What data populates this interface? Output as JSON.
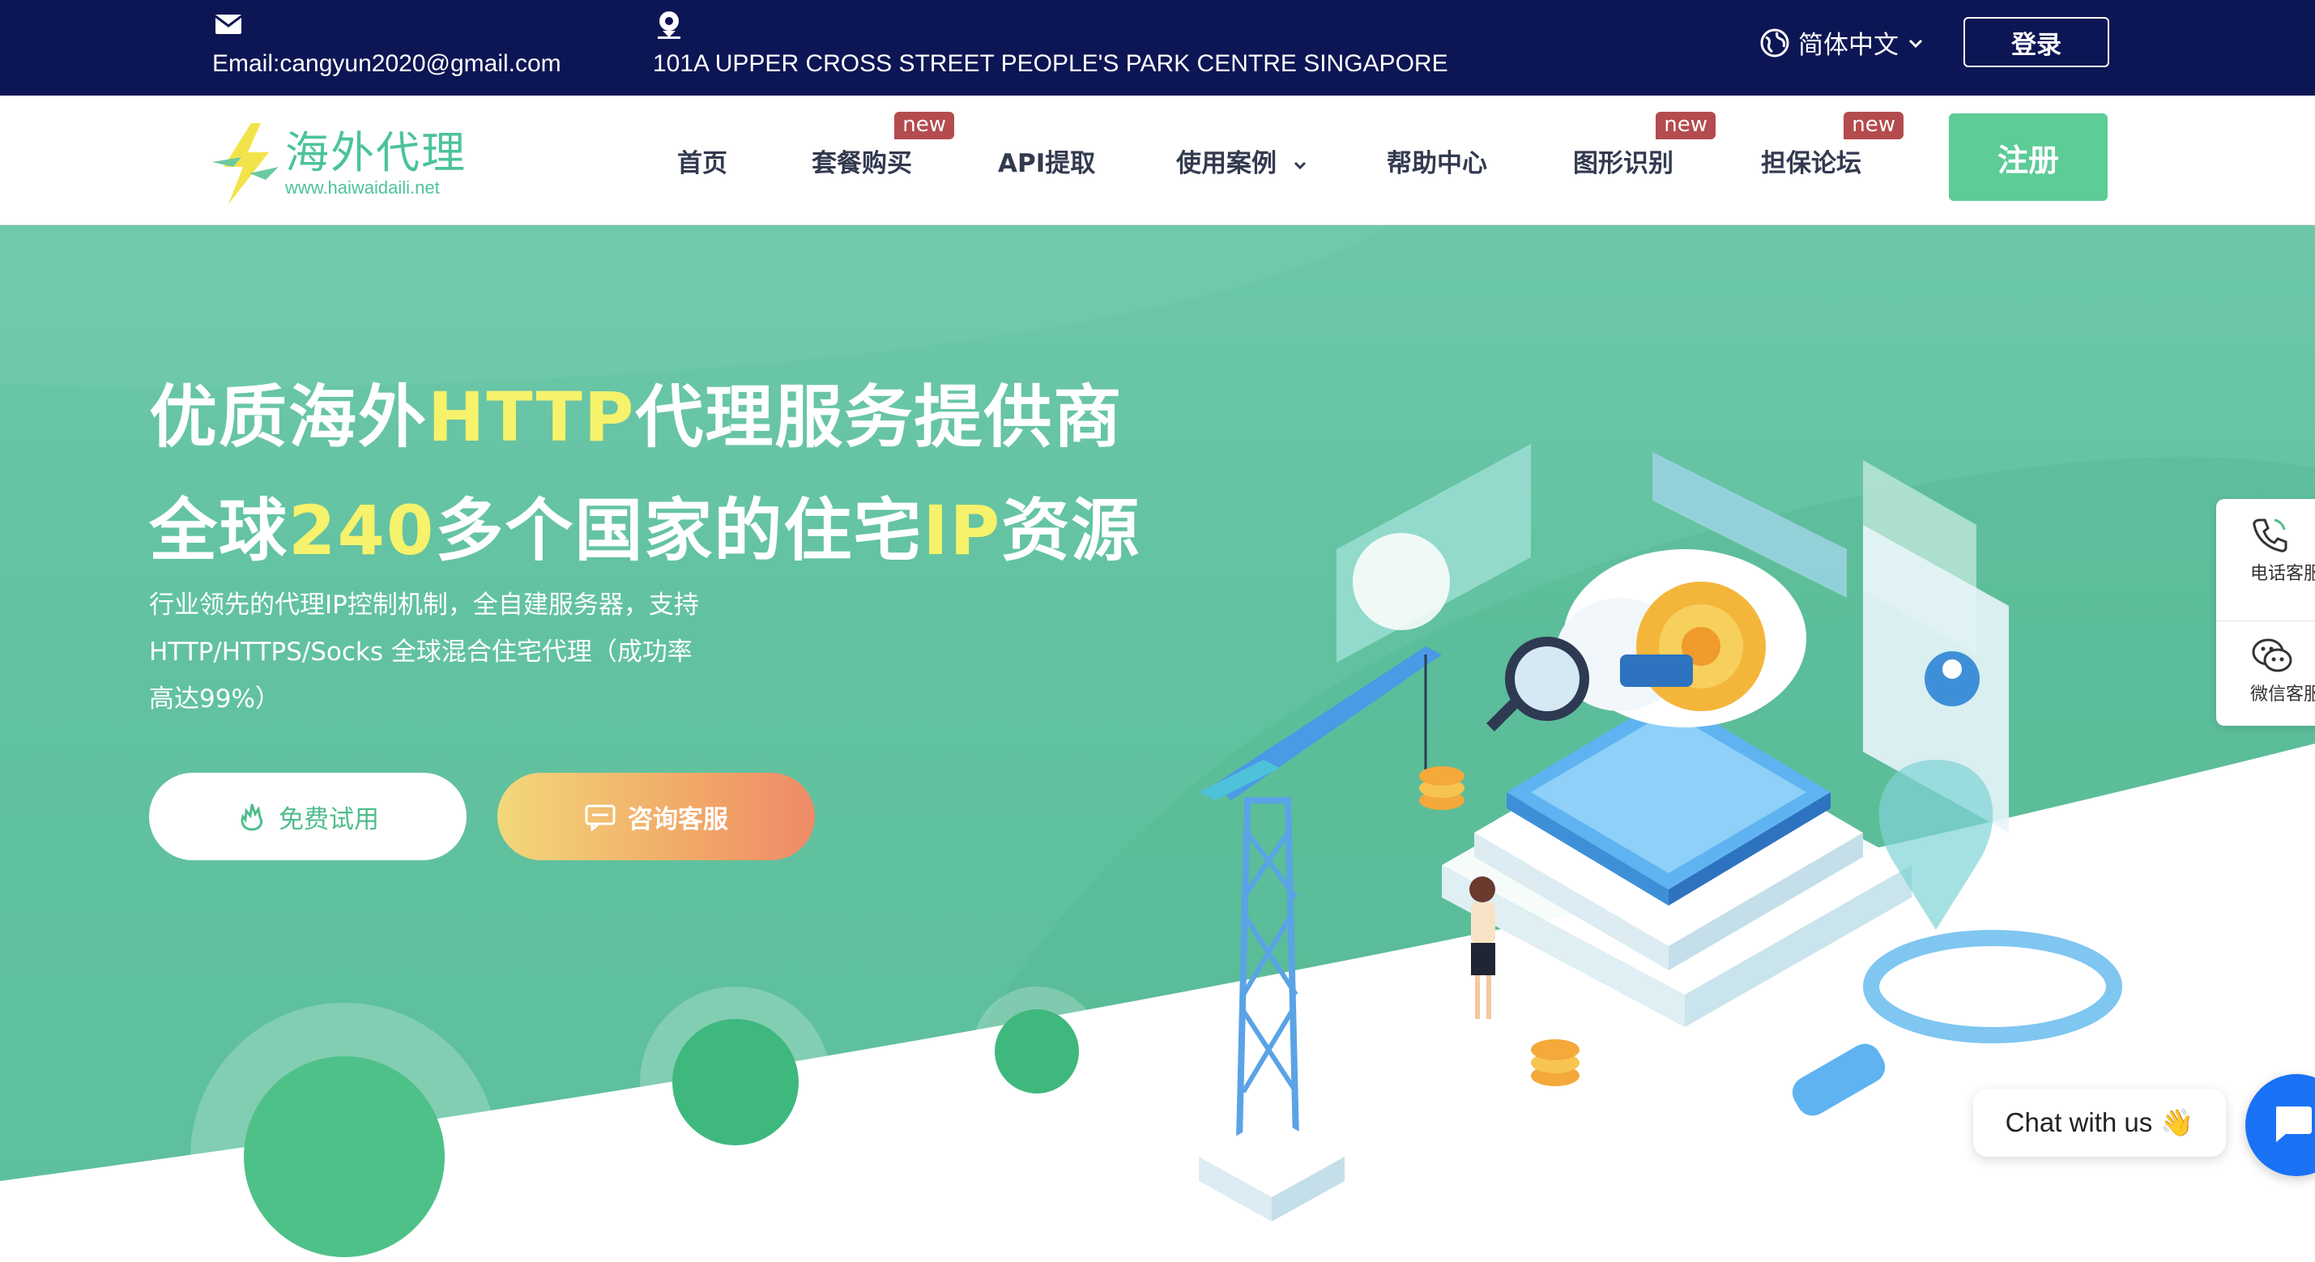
{
  "topbar": {
    "email": "Email:cangyun2020@gmail.com",
    "address": "101A UPPER CROSS STREET PEOPLE'S PARK CENTRE SINGAPORE",
    "language": "简体中文",
    "login_label": "登录"
  },
  "logo": {
    "name": "海外代理",
    "url": "www.haiwaidaili.net"
  },
  "nav": {
    "items": [
      {
        "label": "首页"
      },
      {
        "label": "套餐购买",
        "badge": "new"
      },
      {
        "label": "API提取"
      },
      {
        "label": "使用案例"
      },
      {
        "label": "帮助中心"
      },
      {
        "label": "图形识别",
        "badge": "new"
      },
      {
        "label": "担保论坛",
        "badge": "new"
      }
    ],
    "register_label": "注册"
  },
  "hero": {
    "line1_pre": "优质海外",
    "line1_hl": "HTTP",
    "line1_post": "代理服务提供商",
    "line2_pre": "全球",
    "line2_hl1": "240",
    "line2_mid": "多个国家的住宅",
    "line2_hl2": "IP",
    "line2_post": "资源",
    "desc_line1": "行业领先的代理IP控制机制，全自建服务器，支持",
    "desc_line2": "HTTP/HTTPS/Socks 全球混合住宅代理（成功率",
    "desc_line3": "高达99%）",
    "trial_label": "免费试用",
    "consult_label": "咨询客服"
  },
  "side_panel": {
    "phone_label": "电话客服",
    "wechat_label": "微信客服"
  },
  "chat": {
    "bubble_text": "Chat with us",
    "bubble_emoji": "👋"
  },
  "colors": {
    "topbar_bg": "#0d1654",
    "accent_green": "#5dcc97",
    "badge_red": "#b44b4e",
    "highlight_yellow": "#f6f26b",
    "chat_blue": "#1972f5"
  },
  "icons": {
    "email": "envelope-icon",
    "address": "location-pin-icon",
    "language": "globe-icon",
    "dropdown": "chevron-down-icon",
    "trial": "flame-icon",
    "consult": "chat-icon",
    "phone": "phone-icon",
    "wechat": "wechat-icon",
    "launcher": "message-icon"
  }
}
